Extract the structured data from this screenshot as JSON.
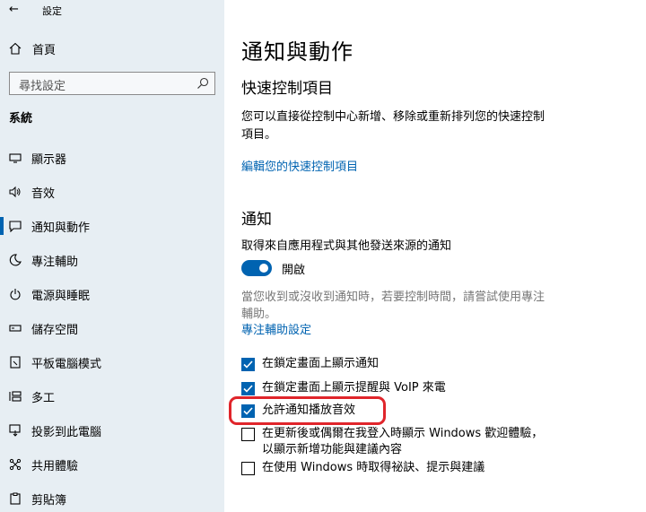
{
  "window": {
    "title": "設定"
  },
  "sidebar": {
    "home_label": "首頁",
    "search_placeholder": "尋找設定",
    "section": "系統",
    "items": [
      {
        "label": "顯示器",
        "icon": "monitor-icon"
      },
      {
        "label": "音效",
        "icon": "speaker-icon"
      },
      {
        "label": "通知與動作",
        "icon": "notification-icon",
        "active": true
      },
      {
        "label": "專注輔助",
        "icon": "moon-icon"
      },
      {
        "label": "電源與睡眠",
        "icon": "power-icon"
      },
      {
        "label": "儲存空間",
        "icon": "storage-icon"
      },
      {
        "label": "平板電腦模式",
        "icon": "tablet-icon"
      },
      {
        "label": "多工",
        "icon": "multitask-icon"
      },
      {
        "label": "投影到此電腦",
        "icon": "project-icon"
      },
      {
        "label": "共用體驗",
        "icon": "shared-icon"
      },
      {
        "label": "剪貼簿",
        "icon": "clipboard-icon"
      }
    ]
  },
  "main": {
    "title": "通知與動作",
    "quick_actions": {
      "heading": "快速控制項目",
      "description_line1": "您可以直接從控制中心新增、移除或重新排列您的快速控制",
      "description_line2": "項目。",
      "edit_link": "編輯您的快速控制項目"
    },
    "notifications": {
      "heading": "通知",
      "get_label": "取得來自應用程式與其他發送來源的通知",
      "toggle_state": "開啟",
      "toggle_on": true,
      "focus_hint_line1": "當您收到或沒收到通知時，若要控制時間，請嘗試使用專注",
      "focus_hint_line2": "輔助。",
      "focus_link": "專注輔助設定",
      "options": [
        {
          "label": "在鎖定畫面上顯示通知",
          "checked": true
        },
        {
          "label": "在鎖定畫面上顯示提醒與 VoIP 來電",
          "checked": true
        },
        {
          "label": "允許通知播放音效",
          "checked": true,
          "highlighted": true
        },
        {
          "label_line1": "在更新後或偶爾在我登入時顯示 Windows 歡迎體驗，",
          "label_line2": "以顯示新增功能與建議內容",
          "checked": false
        },
        {
          "label": "在使用 Windows 時取得祕訣、提示與建議",
          "checked": false
        }
      ]
    }
  },
  "colors": {
    "accent": "#0063b1",
    "sidebar_bg": "#e7eef3",
    "highlight": "#e0252b"
  }
}
